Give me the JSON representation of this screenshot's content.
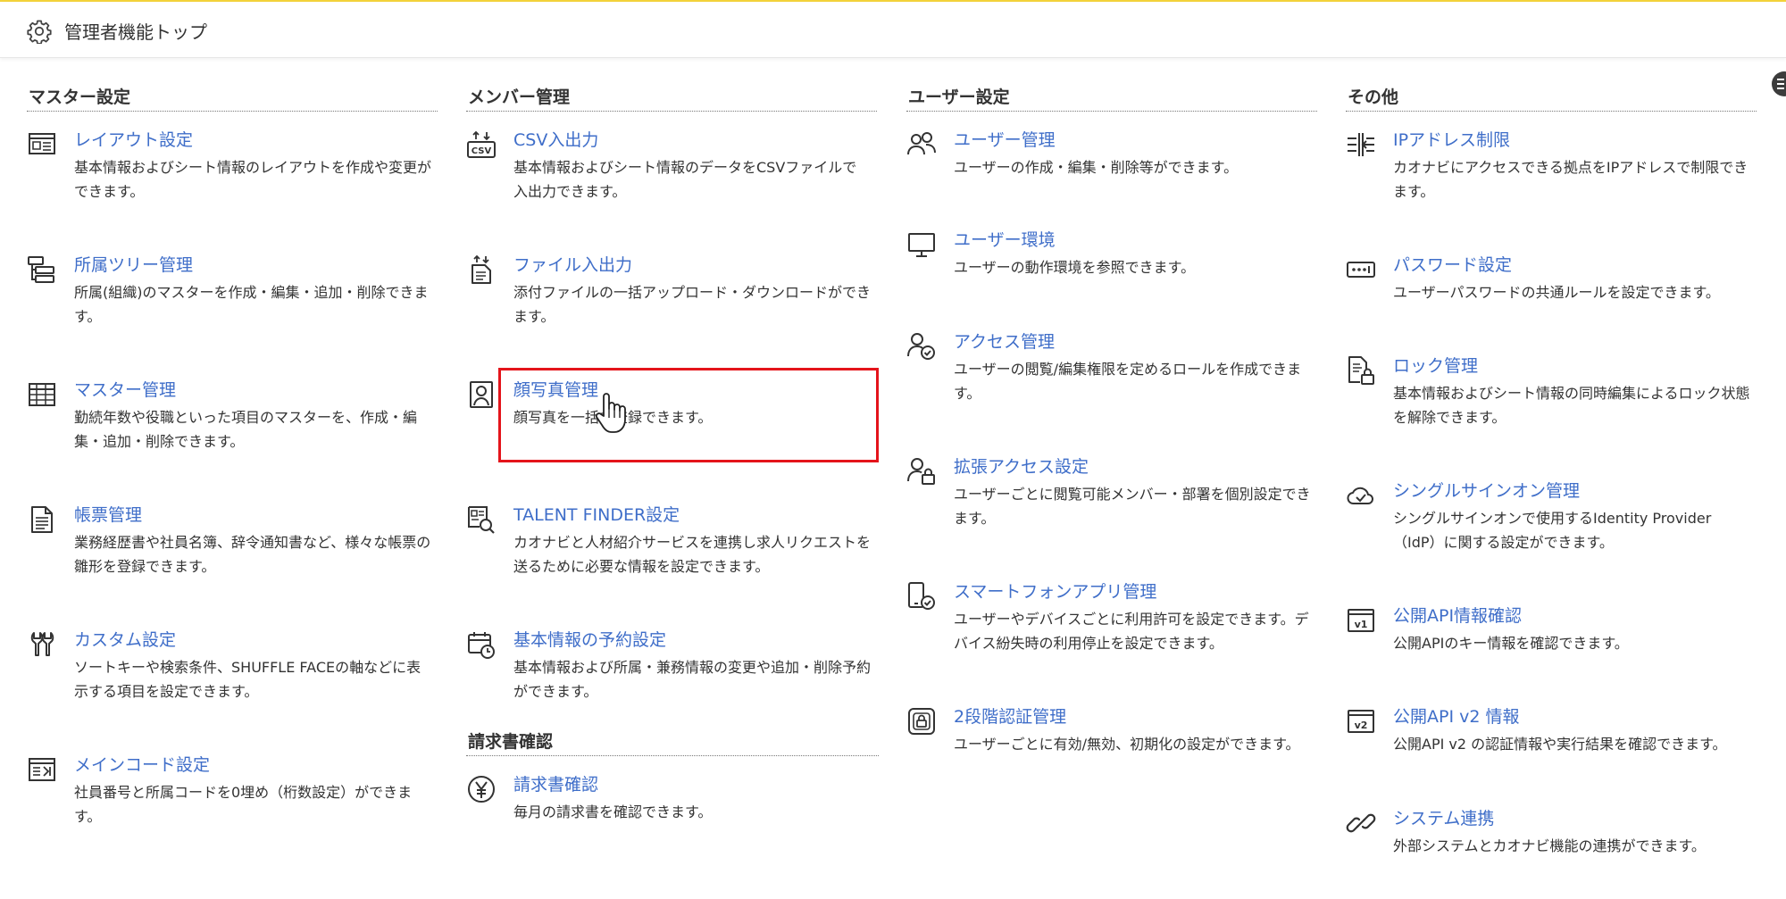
{
  "header": {
    "title": "管理者機能トップ",
    "icon": "gear-icon"
  },
  "columns": [
    {
      "title": "マスター設定",
      "items": [
        {
          "icon": "layout-icon",
          "title": "レイアウト設定",
          "desc": "基本情報およびシート情報のレイアウトを作成や変更ができます。"
        },
        {
          "icon": "tree-icon",
          "title": "所属ツリー管理",
          "desc": "所属(組織)のマスターを作成・編集・追加・削除できます。"
        },
        {
          "icon": "table-icon",
          "title": "マスター管理",
          "desc": "勤続年数や役職といった項目のマスターを、作成・編集・追加・削除できます。"
        },
        {
          "icon": "document-icon",
          "title": "帳票管理",
          "desc": "業務経歴書や社員名簿、辞令通知書など、様々な帳票の雛形を登録できます。"
        },
        {
          "icon": "custom-icon",
          "title": "カスタム設定",
          "desc": "ソートキーや検索条件、SHUFFLE FACEの軸などに表示する項目を設定できます。"
        },
        {
          "icon": "main-code-icon",
          "title": "メインコード設定",
          "desc": "社員番号と所属コードを0埋め（桁数設定）ができます。"
        }
      ]
    },
    {
      "title": "メンバー管理",
      "items": [
        {
          "icon": "csv-icon",
          "title": "CSV入出力",
          "desc": "基本情報およびシート情報のデータをCSVファイルで入出力できます。"
        },
        {
          "icon": "file-transfer-icon",
          "title": "ファイル入出力",
          "desc": "添付ファイルの一括アップロード・ダウンロードができます。"
        },
        {
          "icon": "portrait-icon",
          "title": "顔写真管理",
          "desc": "顔写真を一括で登録できます。"
        },
        {
          "icon": "talent-finder-icon",
          "title": "TALENT FINDER設定",
          "desc": "カオナビと人材紹介サービスを連携し求人リクエストを送るために必要な情報を設定できます。"
        },
        {
          "icon": "calendar-clock-icon",
          "title": "基本情報の予約設定",
          "desc": "基本情報および所属・兼務情報の変更や追加・削除予約ができます。"
        }
      ],
      "sub_section": {
        "title": "請求書確認",
        "items": [
          {
            "icon": "yen-icon",
            "title": "請求書確認",
            "desc": "毎月の請求書を確認できます。"
          }
        ]
      }
    },
    {
      "title": "ユーザー設定",
      "items": [
        {
          "icon": "users-icon",
          "title": "ユーザー管理",
          "desc": "ユーザーの作成・編集・削除等ができます。"
        },
        {
          "icon": "monitor-icon",
          "title": "ユーザー環境",
          "desc": "ユーザーの動作環境を参照できます。"
        },
        {
          "icon": "user-check-icon",
          "title": "アクセス管理",
          "desc": "ユーザーの閲覧/編集権限を定めるロールを作成できます。"
        },
        {
          "icon": "user-lock-icon",
          "title": "拡張アクセス設定",
          "desc": "ユーザーごとに閲覧可能メンバー・部署を個別設定できます。"
        },
        {
          "icon": "smartphone-check-icon",
          "title": "スマートフォンアプリ管理",
          "desc": "ユーザーやデバイスごとに利用許可を設定できます。デバイス紛失時の利用停止を設定できます。"
        },
        {
          "icon": "two-factor-icon",
          "title": "2段階認証管理",
          "desc": "ユーザーごとに有効/無効、初期化の設定ができます。"
        }
      ]
    },
    {
      "title": "その他",
      "items": [
        {
          "icon": "ip-restrict-icon",
          "title": "IPアドレス制限",
          "desc": "カオナビにアクセスできる拠点をIPアドレスで制限できます。"
        },
        {
          "icon": "password-icon",
          "title": "パスワード設定",
          "desc": "ユーザーパスワードの共通ルールを設定できます。"
        },
        {
          "icon": "doc-lock-icon",
          "title": "ロック管理",
          "desc": "基本情報およびシート情報の同時編集によるロック状態を解除できます。"
        },
        {
          "icon": "cloud-check-icon",
          "title": "シングルサインオン管理",
          "desc": "シングルサインオンで使用するIdentity Provider（IdP）に関する設定ができます。"
        },
        {
          "icon": "api-v1-icon",
          "title": "公開API情報確認",
          "desc": "公開APIのキー情報を確認できます。"
        },
        {
          "icon": "api-v2-icon",
          "title": "公開API v2 情報",
          "desc": "公開API v2 の認証情報や実行結果を確認できます。"
        },
        {
          "icon": "link-icon",
          "title": "システム連携",
          "desc": "外部システムとカオナビ機能の連携ができます。"
        }
      ]
    }
  ]
}
